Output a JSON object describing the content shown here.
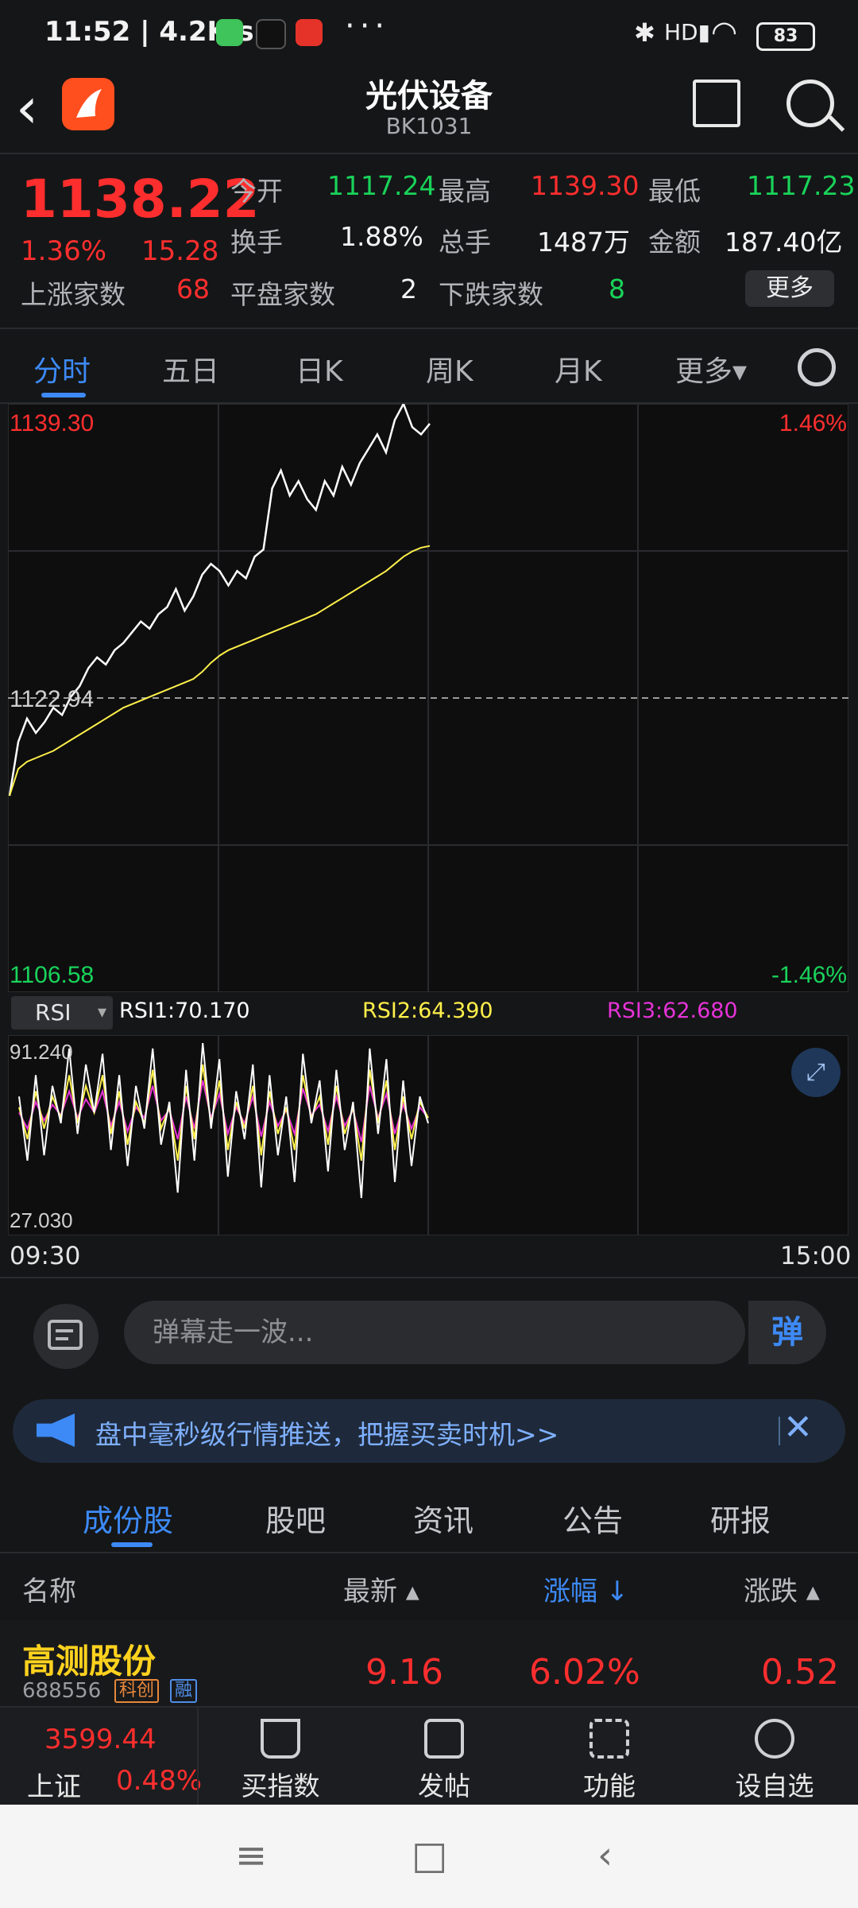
{
  "status_bar": {
    "time": "11:52 | 4.2K/s",
    "more": "···",
    "network": "HD",
    "battery": "83"
  },
  "header": {
    "title": "光伏设备",
    "code": "BK1031"
  },
  "quote": {
    "price": "1138.22",
    "change_pct": "1.36%",
    "change": "15.28",
    "open_label": "今开",
    "open": "1117.24",
    "high_label": "最高",
    "high": "1139.30",
    "low_label": "最低",
    "low": "1117.23",
    "turnover_label": "换手",
    "turnover": "1.88%",
    "volume_label": "总手",
    "volume": "1487万",
    "amount_label": "金额",
    "amount": "187.40亿",
    "up_label": "上涨家数",
    "up": "68",
    "flat_label": "平盘家数",
    "flat": "2",
    "down_label": "下跌家数",
    "down": "8",
    "more_btn": "更多"
  },
  "tabs": [
    "分时",
    "五日",
    "日K",
    "周K",
    "月K",
    "更多▾"
  ],
  "chart": {
    "high": "1139.30",
    "low": "1106.58",
    "prev_close": "1122.94",
    "high_pct": "1.46%",
    "low_pct": "-1.46%"
  },
  "chart_data": {
    "type": "line",
    "ylim": [
      1106.58,
      1139.3
    ],
    "prev_close": 1122.94,
    "series": [
      {
        "values": [
          1117.5,
          1120.5,
          1121.8,
          1121.0,
          1121.6,
          1122.4,
          1122.0,
          1123.0,
          1123.6,
          1124.6,
          1125.2,
          1124.8,
          1125.6,
          1126.0,
          1126.6,
          1127.2,
          1126.8,
          1127.6,
          1128.0,
          1129.0,
          1127.8,
          1128.6,
          1129.8,
          1130.4,
          1130.0,
          1129.2,
          1130.0,
          1129.6,
          1130.8,
          1131.2,
          1134.6,
          1135.6,
          1134.2,
          1135.0,
          1134.0,
          1133.4,
          1135.0,
          1134.2,
          1135.8,
          1134.8,
          1136.0,
          1136.8,
          1137.6,
          1136.6,
          1138.4,
          1139.3,
          1138.0,
          1137.6,
          1138.2
        ]
      },
      {
        "values": [
          1117.5,
          1119.0,
          1119.4,
          1119.6,
          1119.8,
          1120.0,
          1120.3,
          1120.6,
          1120.9,
          1121.2,
          1121.5,
          1121.8,
          1122.1,
          1122.4,
          1122.6,
          1122.8,
          1123.0,
          1123.2,
          1123.4,
          1123.6,
          1123.8,
          1124.0,
          1124.4,
          1124.9,
          1125.3,
          1125.6,
          1125.8,
          1126.0,
          1126.2,
          1126.4,
          1126.6,
          1126.8,
          1127.0,
          1127.2,
          1127.4,
          1127.6,
          1127.9,
          1128.2,
          1128.5,
          1128.8,
          1129.1,
          1129.4,
          1129.7,
          1130.0,
          1130.4,
          1130.8,
          1131.1,
          1131.3,
          1131.4
        ]
      }
    ]
  },
  "rsi": {
    "selector": "RSI",
    "rsi1": "RSI1:70.170",
    "rsi2": "RSI2:64.390",
    "rsi3": "RSI3:62.680",
    "max": "91.240",
    "min": "27.030",
    "start_time": "09:30",
    "end_time": "15:00",
    "rsi1_values": [
      72,
      48,
      80,
      50,
      76,
      62,
      90,
      58,
      84,
      66,
      88,
      52,
      80,
      46,
      76,
      60,
      90,
      54,
      70,
      36,
      82,
      48,
      92,
      60,
      86,
      42,
      74,
      56,
      84,
      38,
      80,
      50,
      72,
      40,
      88,
      62,
      78,
      44,
      82,
      52,
      70,
      34,
      90,
      58,
      86,
      40,
      78,
      46,
      72,
      62
    ],
    "rsi2_values": [
      68,
      56,
      74,
      60,
      72,
      64,
      80,
      62,
      76,
      66,
      80,
      58,
      74,
      54,
      70,
      62,
      82,
      60,
      68,
      48,
      76,
      56,
      84,
      62,
      78,
      52,
      70,
      60,
      76,
      50,
      74,
      58,
      68,
      52,
      80,
      64,
      72,
      54,
      76,
      58,
      68,
      48,
      82,
      62,
      78,
      52,
      72,
      56,
      70,
      64
    ],
    "rsi3_values": [
      66,
      60,
      70,
      63,
      69,
      65,
      74,
      64,
      71,
      66,
      74,
      61,
      70,
      59,
      68,
      64,
      76,
      63,
      67,
      56,
      72,
      60,
      78,
      64,
      73,
      58,
      68,
      62,
      72,
      57,
      70,
      61,
      67,
      58,
      75,
      65,
      69,
      59,
      72,
      61,
      67,
      55,
      76,
      64,
      73,
      58,
      69,
      60,
      68,
      64
    ]
  },
  "colors": {
    "up": "#ff2e2e",
    "down": "#19d35a",
    "accent": "#3d8af7",
    "rsi1": "#ffffff",
    "rsi2": "#fff04a",
    "rsi3": "#e633d8"
  },
  "danmaku": {
    "placeholder": "弹幕走一波...",
    "button": "弹"
  },
  "banner": {
    "text": "盘中毫秒级行情推送，把握买卖时机>>",
    "close": "✕"
  },
  "subtabs": [
    "成份股",
    "股吧",
    "资讯",
    "公告",
    "研报"
  ],
  "table": {
    "headers": {
      "name": "名称",
      "last": "最新 ▴",
      "pct": "涨幅 ↓",
      "chg": "涨跌 ▴"
    },
    "rows": [
      {
        "name": "高测股份",
        "code": "688556",
        "tag1": "科创",
        "tag2": "融",
        "last": "9.16",
        "pct": "6.02%",
        "chg": "0.52"
      }
    ]
  },
  "bottom": {
    "index_value": "3599.44",
    "index_name": "上证",
    "index_pct": "0.48%",
    "items": [
      "买指数",
      "发帖",
      "功能",
      "设自选"
    ]
  },
  "sysnav": {
    "menu": "≡",
    "home": "□",
    "back": "‹"
  }
}
